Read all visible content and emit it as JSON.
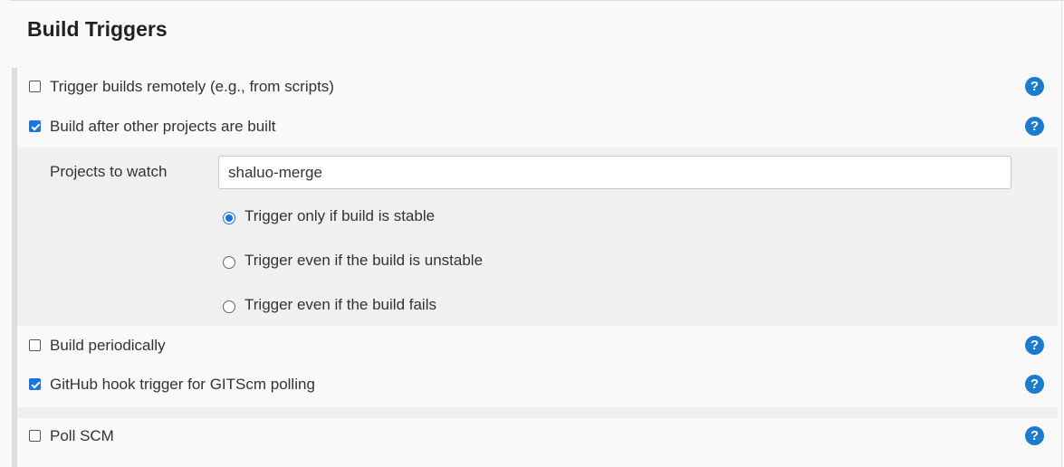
{
  "section": {
    "title": "Build Triggers"
  },
  "triggers": [
    {
      "label": "Trigger builds remotely (e.g., from scripts)",
      "checked": false,
      "help_icon": "question-mark"
    },
    {
      "label": "Build after other projects are built",
      "checked": true,
      "help_icon": "question-mark"
    },
    {
      "label": "Build periodically",
      "checked": false,
      "help_icon": "question-mark"
    },
    {
      "label": "GitHub hook trigger for GITScm polling",
      "checked": true,
      "help_icon": "question-mark"
    },
    {
      "label": "Poll SCM",
      "checked": false,
      "help_icon": "question-mark"
    }
  ],
  "build_after": {
    "projects_label": "Projects to watch",
    "projects_value": "shaluo-merge",
    "options": [
      {
        "label": "Trigger only if build is stable",
        "selected": true
      },
      {
        "label": "Trigger even if the build is unstable",
        "selected": false
      },
      {
        "label": "Trigger even if the build fails",
        "selected": false
      }
    ]
  },
  "help": {
    "glyph": "?"
  },
  "colors": {
    "accent": "#1a73e8",
    "help": "#1a7bd1",
    "panel": "#f0f0f0"
  }
}
